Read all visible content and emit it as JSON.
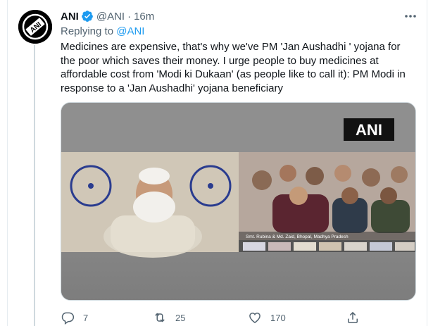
{
  "tweet": {
    "author_name": "ANI",
    "author_handle": "@ANI",
    "separator": "·",
    "time": "16m",
    "replying_label": "Replying to",
    "replying_to": "@ANI",
    "text": "Medicines are expensive, that's why we've PM 'Jan Aushadhi ' yojana for the poor which saves their money. I urge people to buy medicines at affordable cost from 'Modi ki Dukaan' (as people like to call it): PM Modi in response to a 'Jan Aushadhi' yojana beneficiary",
    "verified": true,
    "avatar_text": "ANI"
  },
  "media": {
    "watermark": "ANI",
    "caption": "Smt. Rubina & Md. Zaid, Bhopal, Madhya Pradesh"
  },
  "actions": {
    "reply_count": "7",
    "retweet_count": "25",
    "like_count": "170"
  },
  "icons": {
    "more": "more-dots-icon",
    "verified": "verified-badge-icon",
    "reply": "reply-icon",
    "retweet": "retweet-icon",
    "like": "heart-icon",
    "share": "share-icon"
  },
  "colors": {
    "accent": "#1d9bf0",
    "secondary_text": "#536471",
    "primary_text": "#0f1419"
  }
}
